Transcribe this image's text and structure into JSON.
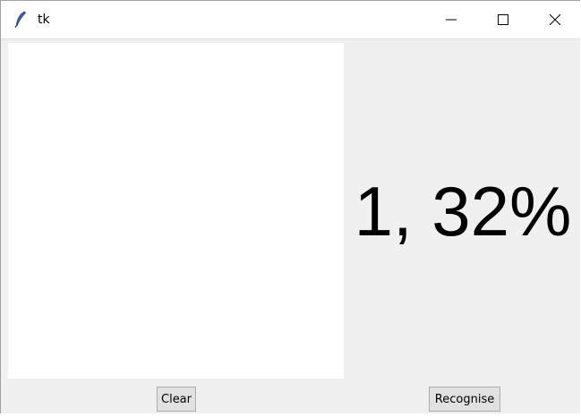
{
  "window": {
    "title": "tk",
    "icon": "feather-icon",
    "controls": {
      "minimize": "minimize-icon",
      "maximize": "maximize-icon",
      "close": "close-icon"
    }
  },
  "main": {
    "result_text": "1, 32%",
    "canvas_background": "#ffffff"
  },
  "buttons": {
    "clear_label": "Clear",
    "recognise_label": "Recognise"
  },
  "colors": {
    "window_bg": "#f0f0f0",
    "titlebar_bg": "#ffffff",
    "button_bg": "#e1e1e1",
    "button_border": "#adadad"
  }
}
